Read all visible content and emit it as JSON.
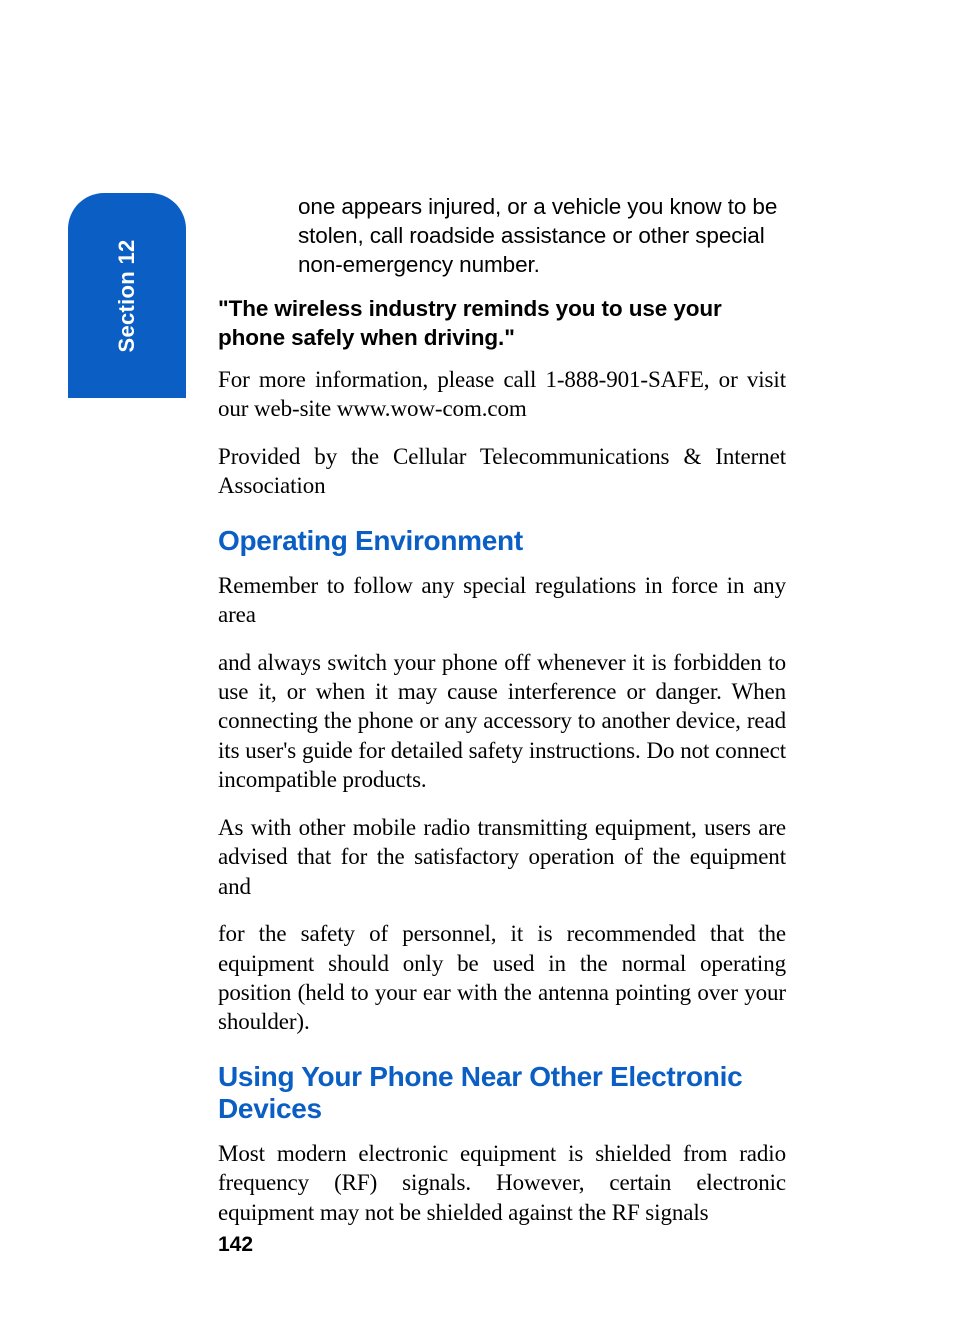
{
  "sidebar": {
    "label": "Section 12"
  },
  "content": {
    "intro_fragment": "one appears injured, or a vehicle you know to be stolen, call roadside assistance or other special non-emergency number.",
    "bold_quote": "\"The wireless industry reminds you to use your phone safely when driving.\"",
    "info_line_1": "For more information, please call 1-888-901-SAFE, or visit our web-site www.wow-com.com",
    "info_line_2": "Provided by the Cellular Telecommunications & Internet Association",
    "heading_1": "Operating Environment",
    "para_1a": "Remember to follow any special regulations in force in any area",
    "para_1b": "and always switch your phone off whenever it is forbidden to use it, or when it may cause interference or danger. When connecting the phone or any accessory to another device, read its user's guide for detailed safety instructions. Do not connect incompatible products.",
    "para_1c": "As with other mobile radio transmitting equipment, users are advised that for the satisfactory operation of the equipment and",
    "para_1d": "for the safety of personnel, it is recommended that the equipment should only be used in the normal operating position (held to your ear with the antenna pointing over your shoulder).",
    "heading_2": "Using Your Phone Near Other Electronic Devices",
    "para_2a": "Most modern electronic equipment is shielded from radio frequency (RF) signals. However, certain electronic equipment may not be shielded against the RF signals"
  },
  "page_number": "142"
}
